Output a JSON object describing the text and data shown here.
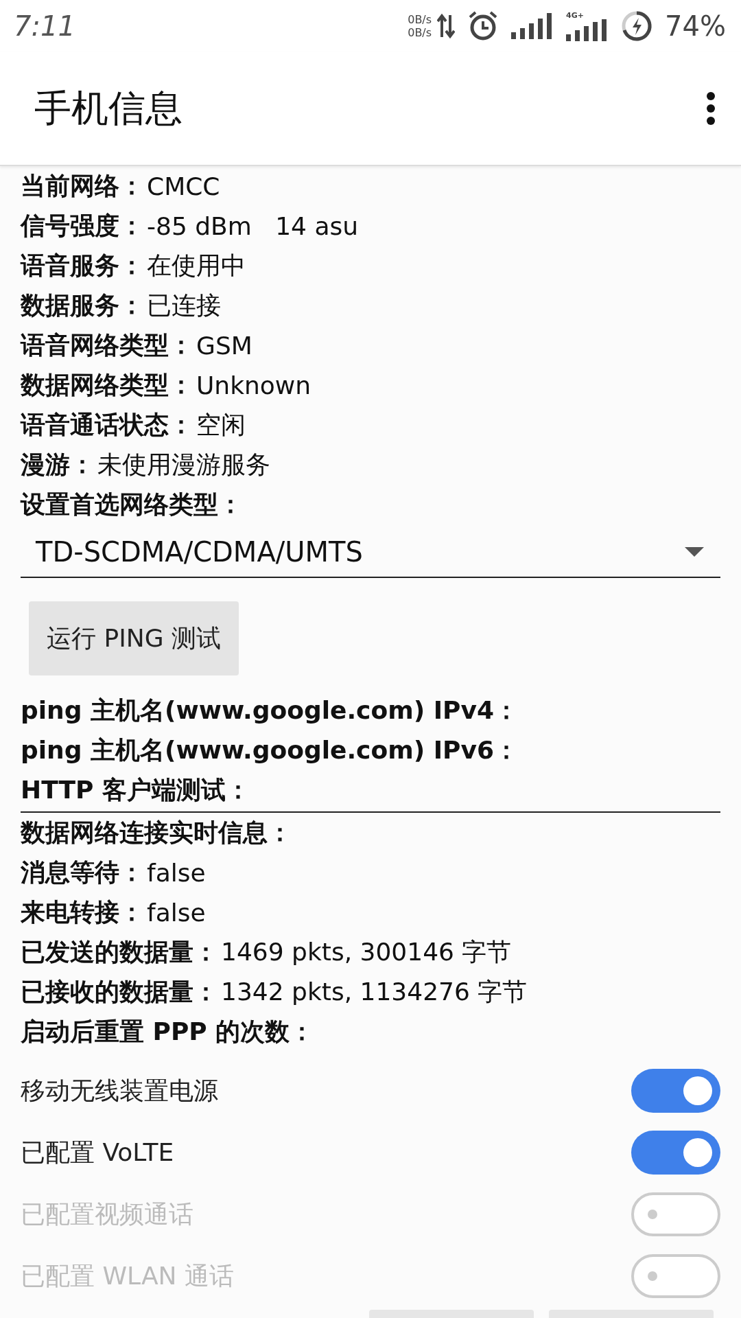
{
  "status_bar": {
    "time": "7:11",
    "upload_speed": "0B/s",
    "download_speed": "0B/s",
    "network_type": "4G+",
    "battery": "74%"
  },
  "app_bar": {
    "title": "手机信息"
  },
  "rows": [
    {
      "kind": "field",
      "label": "当前网络：",
      "value": "CMCC"
    },
    {
      "kind": "field",
      "label": "信号强度：",
      "value": "-85 dBm   14 asu"
    },
    {
      "kind": "field",
      "label": "语音服务：",
      "value": "在使用中"
    },
    {
      "kind": "field",
      "label": "数据服务：",
      "value": "已连接"
    },
    {
      "kind": "field",
      "label": "语音网络类型：",
      "value": "GSM"
    },
    {
      "kind": "field",
      "label": "数据网络类型：",
      "value": "Unknown"
    },
    {
      "kind": "field",
      "label": "语音通话状态：",
      "value": "空闲"
    },
    {
      "kind": "field",
      "label": "漫游：",
      "value": "未使用漫游服务"
    },
    {
      "kind": "heading",
      "label": "设置首选网络类型："
    },
    {
      "kind": "select",
      "value": "TD-SCDMA/CDMA/UMTS"
    },
    {
      "kind": "button",
      "label": "运行 PING 测试"
    },
    {
      "kind": "heading",
      "label": "ping 主机名(www.google.com) IPv4："
    },
    {
      "kind": "heading",
      "label": "ping 主机名(www.google.com) IPv6："
    },
    {
      "kind": "heading",
      "label": "HTTP 客户端测试："
    },
    {
      "kind": "divider"
    },
    {
      "kind": "heading",
      "label": "数据网络连接实时信息："
    },
    {
      "kind": "field",
      "label": "消息等待：",
      "value": "false"
    },
    {
      "kind": "field",
      "label": "来电转接：",
      "value": "false"
    },
    {
      "kind": "field",
      "label": "已发送的数据量：",
      "value": "1469 pkts, 300146 字节"
    },
    {
      "kind": "field",
      "label": "已接收的数据量：",
      "value": "1342 pkts, 1134276 字节"
    },
    {
      "kind": "heading",
      "label": "启动后重置 PPP 的次数："
    }
  ],
  "switches": [
    {
      "label": "移动无线装置电源",
      "on": true,
      "disabled": false
    },
    {
      "label": "已配置 VoLTE",
      "on": true,
      "disabled": false
    },
    {
      "label": "已配置视频通话",
      "on": false,
      "disabled": true
    },
    {
      "label": "已配置 WLAN 通话",
      "on": false,
      "disabled": true
    }
  ]
}
